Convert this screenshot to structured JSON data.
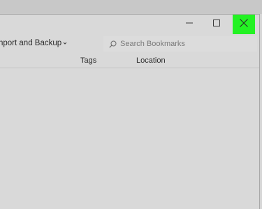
{
  "window": {
    "controls": {
      "minimize_icon": "minimize-icon",
      "maximize_icon": "maximize-icon",
      "close_icon": "close-icon",
      "close_highlight_color": "#23f223"
    }
  },
  "toolbar": {
    "organize_label": "nport and Backup",
    "organize_caret_icon": "chevron-down-icon"
  },
  "search": {
    "icon": "search-icon",
    "placeholder": "Search Bookmarks",
    "value": ""
  },
  "columns": {
    "headers": [
      "Tags",
      "Location"
    ]
  }
}
